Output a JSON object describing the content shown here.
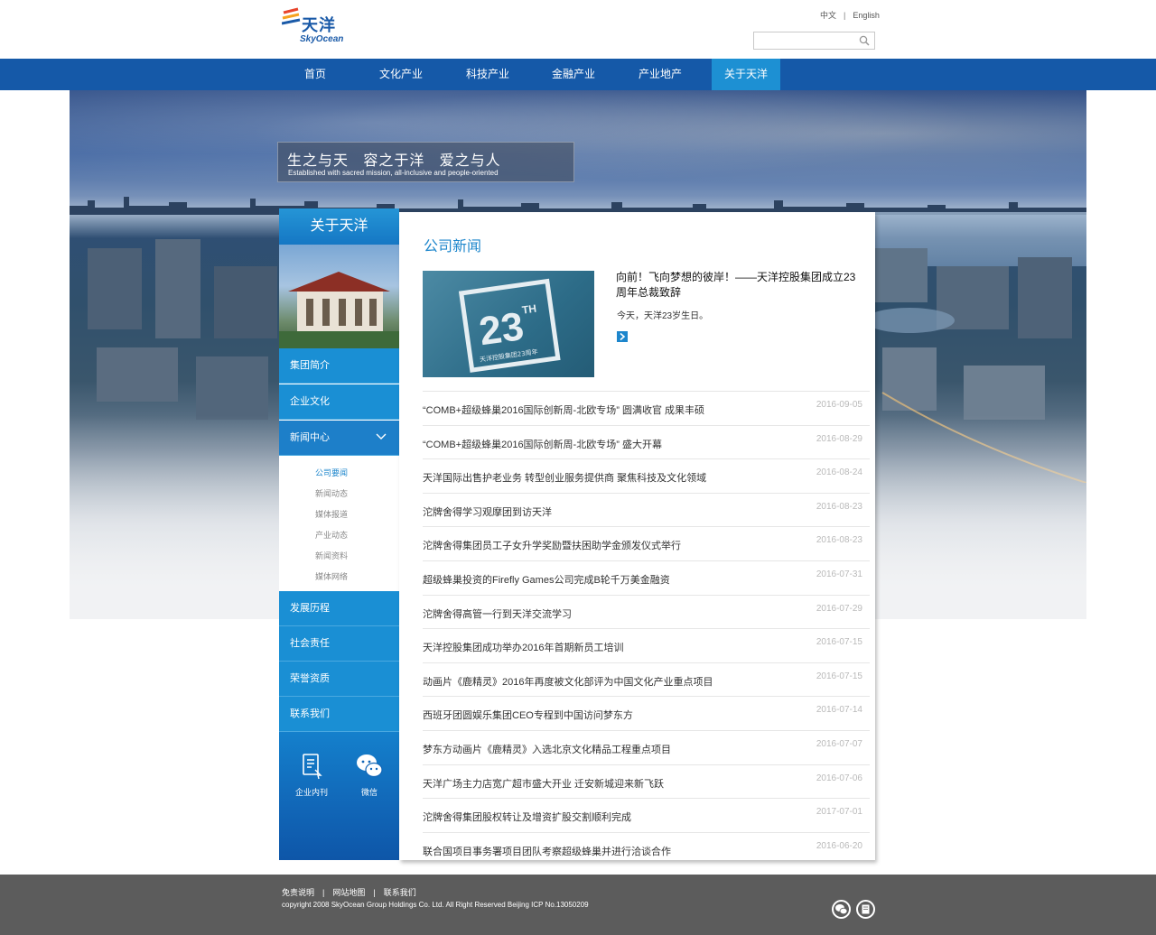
{
  "logo": {
    "cn": "天洋",
    "en": "SkyOcean"
  },
  "lang": {
    "zh": "中文",
    "en": "English"
  },
  "search": {
    "placeholder": ""
  },
  "nav": [
    "首页",
    "文化产业",
    "科技产业",
    "金融产业",
    "产业地产",
    "关于天洋"
  ],
  "nav_active": "关于天洋",
  "slogan": {
    "cn": "生之与天   容之于洋   爱之与人",
    "en": "Established with sacred mission, all-inclusive and people-oriented"
  },
  "sidebar": {
    "title": "关于天洋",
    "items_top": [
      "集团简介",
      "企业文化",
      "新闻中心"
    ],
    "sub_items": [
      "公司要闻",
      "新闻动态",
      "媒体报道",
      "产业动态",
      "新闻资料",
      "媒体网络"
    ],
    "sub_active": "公司要闻",
    "items_bottom": [
      "发展历程",
      "社会责任",
      "荣誉资质",
      "联系我们"
    ],
    "buttons": [
      "企业内刊",
      "微信"
    ]
  },
  "main": {
    "title": "公司新闻",
    "featured": {
      "image_text": "23",
      "image_sup": "TH",
      "image_caption": "天洋控股集团23周年",
      "title": "向前！飞向梦想的彼岸！——天洋控股集团成立23周年总裁致辞",
      "desc": "今天，天洋23岁生日。"
    },
    "news": [
      {
        "title": "“COMB+超级蜂巢2016国际创新周-北欧专场” 圆满收官 成果丰硕",
        "date": "2016-09-05"
      },
      {
        "title": "“COMB+超级蜂巢2016国际创新周-北欧专场” 盛大开幕",
        "date": "2016-08-29"
      },
      {
        "title": "天洋国际出售护老业务 转型创业服务提供商 聚焦科技及文化领域",
        "date": "2016-08-24"
      },
      {
        "title": "沱牌舍得学习观摩团到访天洋",
        "date": "2016-08-23"
      },
      {
        "title": "沱牌舍得集团员工子女升学奖励暨扶困助学金颁发仪式举行",
        "date": "2016-08-23"
      },
      {
        "title": "超级蜂巢投资的Firefly Games公司完成B轮千万美金融资",
        "date": "2016-07-31"
      },
      {
        "title": "沱牌舍得高管一行到天洋交流学习",
        "date": "2016-07-29"
      },
      {
        "title": "天洋控股集团成功举办2016年首期新员工培训",
        "date": "2016-07-15"
      },
      {
        "title": "动画片《鹿精灵》2016年再度被文化部评为中国文化产业重点项目",
        "date": "2016-07-15"
      },
      {
        "title": "西班牙团圆娱乐集团CEO专程到中国访问梦东方",
        "date": "2016-07-14"
      },
      {
        "title": "梦东方动画片《鹿精灵》入选北京文化精品工程重点项目",
        "date": "2016-07-07"
      },
      {
        "title": "天洋广场主力店宽广超市盛大开业 迁安新城迎来新飞跃",
        "date": "2016-07-06"
      },
      {
        "title": "沱牌舍得集团股权转让及增资扩股交割顺利完成",
        "date": "2017-07-01"
      },
      {
        "title": "联合国项目事务署项目团队考察超级蜂巢并进行洽谈合作",
        "date": "2016-06-20"
      }
    ]
  },
  "footer": {
    "links": [
      "免责说明",
      "网站地图",
      "联系我们"
    ],
    "copyright": "copyright 2008 SkyOcean Group Holdings Co.  Ltd. All Right Reserved Beijing ICP No.13050209",
    "icons": [
      "wechat-icon",
      "magazine-icon"
    ]
  },
  "colors": {
    "nav": "#1559a8",
    "nav_active": "#1d90d3",
    "accent": "#1d86cc",
    "footer": "#5c5c5c"
  }
}
